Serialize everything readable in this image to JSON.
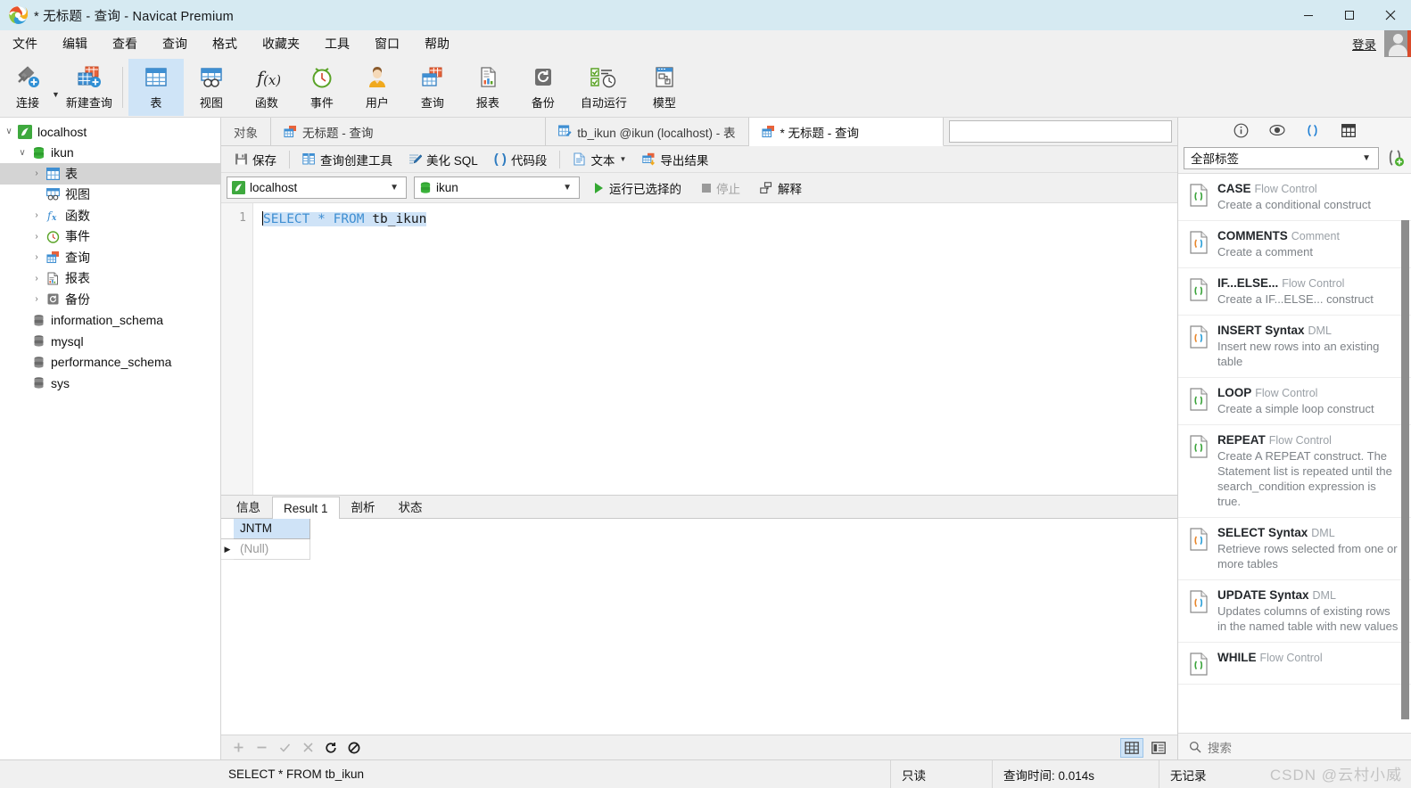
{
  "window": {
    "title": "* 无标题 - 查询 - Navicat Premium",
    "minimize": "—",
    "maximize": "☐",
    "close": "✕"
  },
  "menubar": {
    "items": [
      {
        "label": "文件"
      },
      {
        "label": "编辑"
      },
      {
        "label": "查看"
      },
      {
        "label": "查询"
      },
      {
        "label": "格式"
      },
      {
        "label": "收藏夹"
      },
      {
        "label": "工具"
      },
      {
        "label": "窗口"
      },
      {
        "label": "帮助"
      }
    ],
    "login_label": "登录"
  },
  "toolbar": {
    "items": [
      {
        "label": "连接",
        "icon": "connection-icon",
        "active": false
      },
      {
        "label": "新建查询",
        "icon": "new-query-icon",
        "active": false
      },
      {
        "label": "表",
        "icon": "table-icon",
        "active": true
      },
      {
        "label": "视图",
        "icon": "view-icon",
        "active": false
      },
      {
        "label": "函数",
        "icon": "function-icon",
        "active": false
      },
      {
        "label": "事件",
        "icon": "event-icon",
        "active": false
      },
      {
        "label": "用户",
        "icon": "user-icon",
        "active": false
      },
      {
        "label": "查询",
        "icon": "query-icon",
        "active": false
      },
      {
        "label": "报表",
        "icon": "report-icon",
        "active": false
      },
      {
        "label": "备份",
        "icon": "backup-icon",
        "active": false
      },
      {
        "label": "自动运行",
        "icon": "automation-icon",
        "active": false
      },
      {
        "label": "模型",
        "icon": "model-icon",
        "active": false
      }
    ]
  },
  "sidebar": {
    "items": [
      {
        "label": "localhost",
        "depth": 0,
        "chev": "open",
        "icon": "connection-host-icon",
        "selected": false
      },
      {
        "label": "ikun",
        "depth": 1,
        "chev": "open",
        "icon": "database-icon",
        "selected": false
      },
      {
        "label": "表",
        "depth": 2,
        "chev": "closed",
        "icon": "table-icon",
        "selected": true
      },
      {
        "label": "视图",
        "depth": 2,
        "chev": "none",
        "icon": "view-icon",
        "selected": false
      },
      {
        "label": "函数",
        "depth": 2,
        "chev": "closed",
        "icon": "function-icon",
        "selected": false
      },
      {
        "label": "事件",
        "depth": 2,
        "chev": "closed",
        "icon": "event-icon",
        "selected": false
      },
      {
        "label": "查询",
        "depth": 2,
        "chev": "closed",
        "icon": "query-icon",
        "selected": false
      },
      {
        "label": "报表",
        "depth": 2,
        "chev": "closed",
        "icon": "report-icon",
        "selected": false
      },
      {
        "label": "备份",
        "depth": 2,
        "chev": "closed",
        "icon": "backup-icon",
        "selected": false
      },
      {
        "label": "information_schema",
        "depth": 1,
        "chev": "none",
        "icon": "database-icon",
        "selected": false
      },
      {
        "label": "mysql",
        "depth": 1,
        "chev": "none",
        "icon": "database-icon",
        "selected": false
      },
      {
        "label": "performance_schema",
        "depth": 1,
        "chev": "none",
        "icon": "database-icon",
        "selected": false
      },
      {
        "label": "sys",
        "depth": 1,
        "chev": "none",
        "icon": "database-icon",
        "selected": false
      }
    ]
  },
  "tabs": {
    "object_label": "对象",
    "items": [
      {
        "label": "无标题 - 查询",
        "icon": "query-tab-icon",
        "active": false
      },
      {
        "label": "tb_ikun @ikun (localhost) - 表",
        "icon": "table-tab-icon",
        "active": false
      },
      {
        "label": "* 无标题 - 查询",
        "icon": "query-tab-icon",
        "active": true
      }
    ]
  },
  "query_toolbar": {
    "save_label": "保存",
    "builder_label": "查询创建工具",
    "beautify_label": "美化 SQL",
    "snippet_label": "代码段",
    "text_label": "文本",
    "export_label": "导出结果"
  },
  "query_bar": {
    "connection": "localhost",
    "database": "ikun",
    "run_selected_label": "运行已选择的",
    "stop_label": "停止",
    "explain_label": "解释"
  },
  "editor": {
    "line_number": "1",
    "sql_keyword1": "SELECT",
    "sql_star": "*",
    "sql_keyword2": "FROM",
    "sql_table": "tb_ikun",
    "full_sql": "SELECT * FROM tb_ikun"
  },
  "results": {
    "tabs": [
      {
        "label": "信息",
        "active": false
      },
      {
        "label": "Result 1",
        "active": true
      },
      {
        "label": "剖析",
        "active": false
      },
      {
        "label": "状态",
        "active": false
      }
    ],
    "columns": [
      "JNTM"
    ],
    "rows": [
      [
        "(Null)"
      ]
    ],
    "grid_buttons": [
      {
        "icon": "plus-icon",
        "name": "add-record-button",
        "enabled": false,
        "glyph": "+"
      },
      {
        "icon": "minus-icon",
        "name": "delete-record-button",
        "enabled": false,
        "glyph": "−"
      },
      {
        "icon": "check-icon",
        "name": "apply-changes-button",
        "enabled": false,
        "glyph": "✓"
      },
      {
        "icon": "cross-icon",
        "name": "cancel-changes-button",
        "enabled": false,
        "glyph": "✕"
      },
      {
        "icon": "refresh-icon",
        "name": "refresh-button",
        "enabled": true,
        "glyph": "↻"
      },
      {
        "icon": "stop-icon",
        "name": "stop-button",
        "enabled": true,
        "glyph": "⊘"
      }
    ]
  },
  "right_panel": {
    "icons": [
      {
        "name": "info-icon",
        "glyph": "ⓘ",
        "active": false
      },
      {
        "name": "eye-icon",
        "glyph": "◉",
        "active": false
      },
      {
        "name": "code-snippet-icon",
        "glyph": "()",
        "active": true
      },
      {
        "name": "grid-icon",
        "glyph": "▦",
        "active": false
      }
    ],
    "filter_value": "全部标签",
    "search_placeholder": "搜索",
    "snippets": [
      {
        "title": "CASE",
        "category": "Flow Control",
        "desc": "Create a conditional construct",
        "color": "green"
      },
      {
        "title": "COMMENTS",
        "category": "Comment",
        "desc": "Create a comment",
        "color": "orange"
      },
      {
        "title": "IF...ELSE...",
        "category": "Flow Control",
        "desc": "Create a IF...ELSE... construct",
        "color": "green"
      },
      {
        "title": "INSERT Syntax",
        "category": "DML",
        "desc": "Insert new rows into an existing table",
        "color": "orange"
      },
      {
        "title": "LOOP",
        "category": "Flow Control",
        "desc": "Create a simple loop construct",
        "color": "green"
      },
      {
        "title": "REPEAT",
        "category": "Flow Control",
        "desc": "Create A REPEAT construct. The Statement list is repeated until the search_condition expression is true.",
        "color": "green"
      },
      {
        "title": "SELECT Syntax",
        "category": "DML",
        "desc": "Retrieve rows selected from one or more tables",
        "color": "orange"
      },
      {
        "title": "UPDATE Syntax",
        "category": "DML",
        "desc": "Updates columns of existing rows in the named table with new values",
        "color": "orange"
      },
      {
        "title": "WHILE",
        "category": "Flow Control",
        "desc": "",
        "color": "green"
      }
    ]
  },
  "statusbar": {
    "sql": "SELECT * FROM tb_ikun",
    "readonly": "只读",
    "query_time": "查询时间: 0.014s",
    "records": "无记录"
  },
  "watermark": "CSDN @云村小威",
  "colors": {
    "titlebar_bg": "#d6eaf2",
    "accent_blue": "#3f8fd2",
    "selection_blue": "#cfe3f7",
    "toolbar_bg": "#f0f0f0",
    "tree_selected": "#d4d4d4"
  }
}
